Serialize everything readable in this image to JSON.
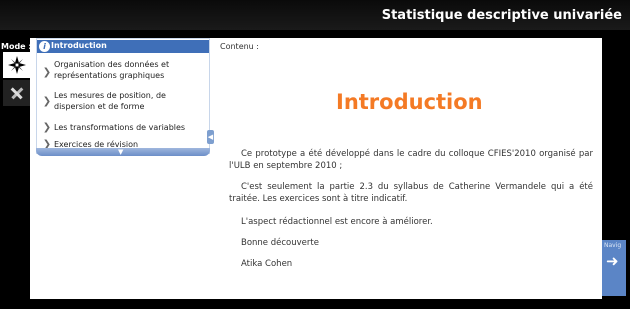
{
  "header": {
    "title": "Statistique descriptive univariée"
  },
  "mode": {
    "label": "Mode :"
  },
  "menu": {
    "items": [
      {
        "label": "Introduction",
        "selected": true
      },
      {
        "label": "Organisation des données et représentations graphiques"
      },
      {
        "label": "Les mesures de position, de dispersion et de forme"
      },
      {
        "label": "Les transformations de variables"
      },
      {
        "label": "Exercices de révision"
      }
    ]
  },
  "content": {
    "label": "Contenu :",
    "heading": "Introduction",
    "paragraphs": [
      "Ce prototype a été développé dans le cadre du colloque CFIES'2010 organisé par l'ULB en septembre 2010 ;",
      "C'est seulement la partie 2.3 du syllabus de Catherine Vermandele qui a été traitée. Les exercices sont à titre indicatif.",
      "L'aspect rédactionnel est encore à améliorer.",
      "Bonne découverte",
      "Atika Cohen"
    ]
  },
  "nav": {
    "label": "Navig"
  },
  "colors": {
    "accent": "#3f6fb8",
    "heading": "#f47a25"
  }
}
